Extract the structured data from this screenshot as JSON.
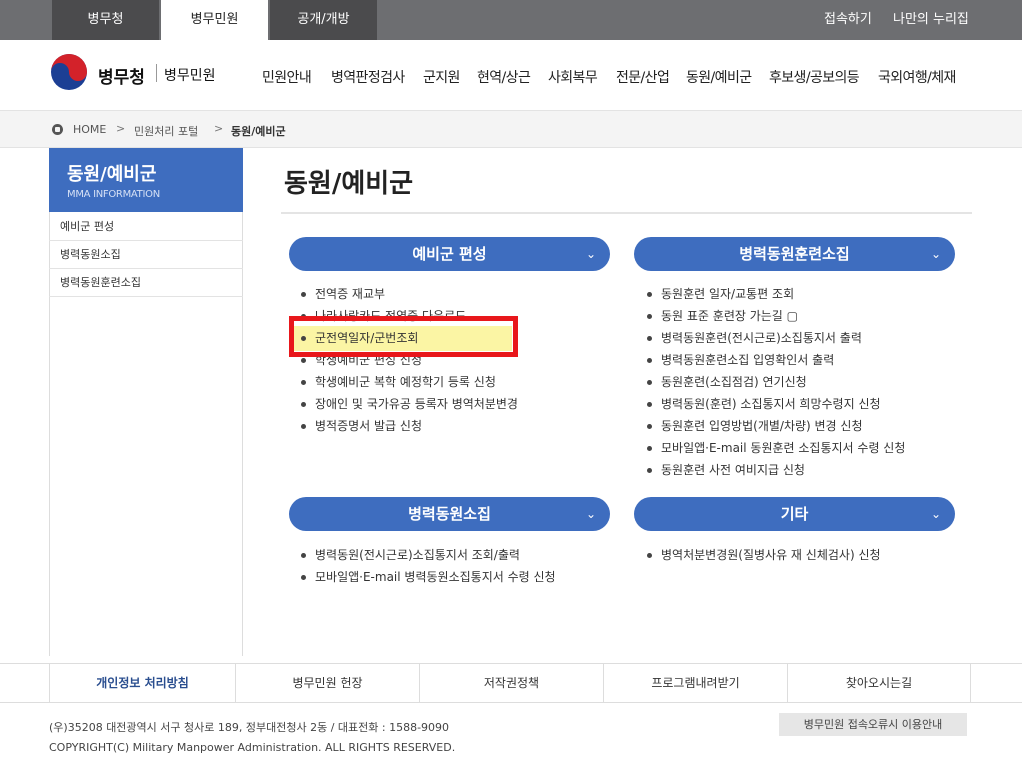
{
  "topbar": {
    "tabs": [
      "병무청",
      "병무민원",
      "공개/개방"
    ],
    "links": [
      "접속하기",
      "나만의 누리집"
    ]
  },
  "header": {
    "brand": "병무청",
    "brand_sub": "병무민원",
    "nav": [
      "민원안내",
      "병역판정검사",
      "군지원",
      "현역/상근",
      "사회복무",
      "전문/산업",
      "동원/예비군",
      "후보생/공보의등",
      "국외여행/체재"
    ]
  },
  "breadcrumb": [
    "HOME",
    "민원처리 포털",
    "동원/예비군"
  ],
  "sidebar": {
    "title": "동원/예비군",
    "subtitle": "MMA INFORMATION",
    "items": [
      "예비군 편성",
      "병력동원소집",
      "병력동원훈련소집"
    ]
  },
  "main": {
    "title": "동원/예비군",
    "sections": [
      {
        "title": "예비군 편성",
        "items": [
          "전역증 재교부",
          "나라사랑카드 전역증 다운로드",
          "군전역일자/군번조회",
          "학생예비군 편성 신청",
          "학생예비군 복학 예정학기 등록 신청",
          "장애인 및 국가유공 등록자 병역처분변경",
          "병적증명서 발급 신청"
        ]
      },
      {
        "title": "병력동원훈련소집",
        "items": [
          "동원훈련 일자/교통편 조회",
          "동원 표준 훈련장 가는길 ▢",
          "병력동원훈련(전시근로)소집통지서 출력",
          "병력동원훈련소집 입영확인서 출력",
          "동원훈련(소집점검) 연기신청",
          "병력동원(훈련) 소집통지서 희망수령지 신청",
          "동원훈련 입영방법(개별/차량) 변경 신청",
          "모바일앱·E-mail 동원훈련 소집통지서 수령 신청",
          "동원훈련 사전 여비지급 신청"
        ]
      },
      {
        "title": "병력동원소집",
        "items": [
          "병력동원(전시근로)소집통지서 조회/출력",
          "모바일앱·E-mail 병력동원소집통지서 수령 신청"
        ]
      },
      {
        "title": "기타",
        "items": [
          "병역처분변경원(질병사유 재 신체검사) 신청"
        ]
      }
    ],
    "chevron": "⌄"
  },
  "footer": {
    "nav": [
      "개인정보 처리방침",
      "병무민원 헌장",
      "저작권정책",
      "프로그램내려받기",
      "찾아오시는길"
    ],
    "address": "(우)35208 대전광역시 서구 청사로 189, 정부대전청사 2동 / 대표전화 : 1588-9090",
    "copyright": "COPYRIGHT(C) Military Manpower Administration. ALL RIGHTS RESERVED.",
    "error_button": "병무민원 접속오류시 이용안내"
  },
  "colors": {
    "accent": "#3e6dbf",
    "topbar": "#6d6e71",
    "highlight_border": "#e8171b"
  }
}
